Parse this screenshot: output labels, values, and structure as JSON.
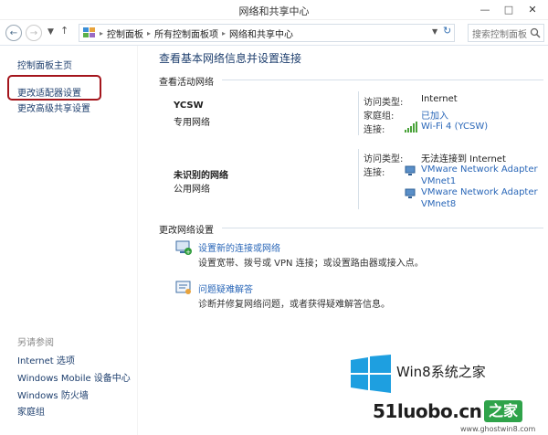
{
  "window": {
    "title": "网络和共享中心"
  },
  "address": {
    "crumbs": [
      "控制面板",
      "所有控制面板项",
      "网络和共享中心"
    ],
    "search_placeholder": "搜索控制面板"
  },
  "sidebar": {
    "home": "控制面板主页",
    "items": [
      "更改适配器设置",
      "更改高级共享设置"
    ],
    "see_also_header": "另请参阅",
    "see_also": [
      "Internet 选项",
      "Windows Mobile 设备中心",
      "Windows 防火墙",
      "家庭组"
    ]
  },
  "main": {
    "heading": "查看基本网络信息并设置连接",
    "active_header": "查看活动网络",
    "networks": [
      {
        "name": "YCSW",
        "type": "专用网络",
        "access_label": "访问类型:",
        "access_value": "Internet",
        "homegroup_label": "家庭组:",
        "homegroup_value": "已加入",
        "connection_label": "连接:",
        "connection_value": "Wi-Fi 4 (YCSW)"
      },
      {
        "name": "未识别的网络",
        "type": "公用网络",
        "access_label": "访问类型:",
        "access_value": "无法连接到 Internet",
        "connection_label": "连接:",
        "connections": [
          "VMware Network Adapter",
          "VMnet1",
          "VMware Network Adapter",
          "VMnet8"
        ]
      }
    ],
    "change_header": "更改网络设置",
    "tasks": [
      {
        "icon": "new-connection-icon",
        "link": "设置新的连接或网络",
        "desc": "设置宽带、拨号或 VPN 连接；或设置路由器或接入点。"
      },
      {
        "icon": "troubleshoot-icon",
        "link": "问题疑难解答",
        "desc": "诊断并修复网络问题，或者获得疑难解答信息。"
      }
    ]
  },
  "watermark": {
    "brand": "Win8系统之家",
    "site_main": "51luobo.cn",
    "site_suffix": "之家",
    "site_small": "www.ghostwin8.com"
  },
  "colors": {
    "link": "#2a67b8",
    "heading": "#1e3f6e",
    "highlight": "#a4151c",
    "logo_blue": "#1e9fe0"
  }
}
